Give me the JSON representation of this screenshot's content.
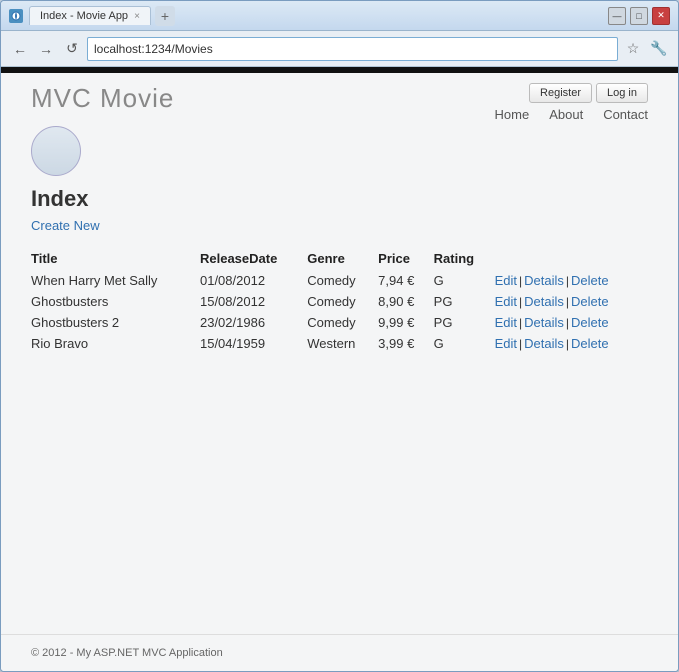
{
  "window": {
    "title": "Index - Movie App",
    "tab_close": "×",
    "controls": [
      "—",
      "□",
      "×"
    ]
  },
  "addressbar": {
    "back_label": "←",
    "forward_label": "→",
    "reload_label": "↺",
    "url": "localhost:1234/Movies",
    "star_label": "☆",
    "wrench_label": "🔧"
  },
  "header": {
    "logo": "MVC Movie",
    "auth": {
      "register": "Register",
      "login": "Log in"
    },
    "nav": [
      {
        "label": "Home"
      },
      {
        "label": "About"
      },
      {
        "label": "Contact"
      }
    ]
  },
  "main": {
    "title": "Index",
    "create_new": "Create New",
    "table": {
      "columns": [
        "Title",
        "ReleaseDate",
        "Genre",
        "Price",
        "Rating"
      ],
      "rows": [
        {
          "title": "When Harry Met Sally",
          "releasedate": "01/08/2012",
          "genre": "Comedy",
          "price": "7,94 €",
          "rating": "G"
        },
        {
          "title": "Ghostbusters",
          "releasedate": "15/08/2012",
          "genre": "Comedy",
          "price": "8,90 €",
          "rating": "PG"
        },
        {
          "title": "Ghostbusters 2",
          "releasedate": "23/02/1986",
          "genre": "Comedy",
          "price": "9,99 €",
          "rating": "PG"
        },
        {
          "title": "Rio Bravo",
          "releasedate": "15/04/1959",
          "genre": "Western",
          "price": "3,99 €",
          "rating": "G"
        }
      ],
      "actions": [
        "Edit",
        "Details",
        "Delete"
      ]
    }
  },
  "footer": {
    "text": "© 2012 - My ASP.NET MVC Application"
  }
}
